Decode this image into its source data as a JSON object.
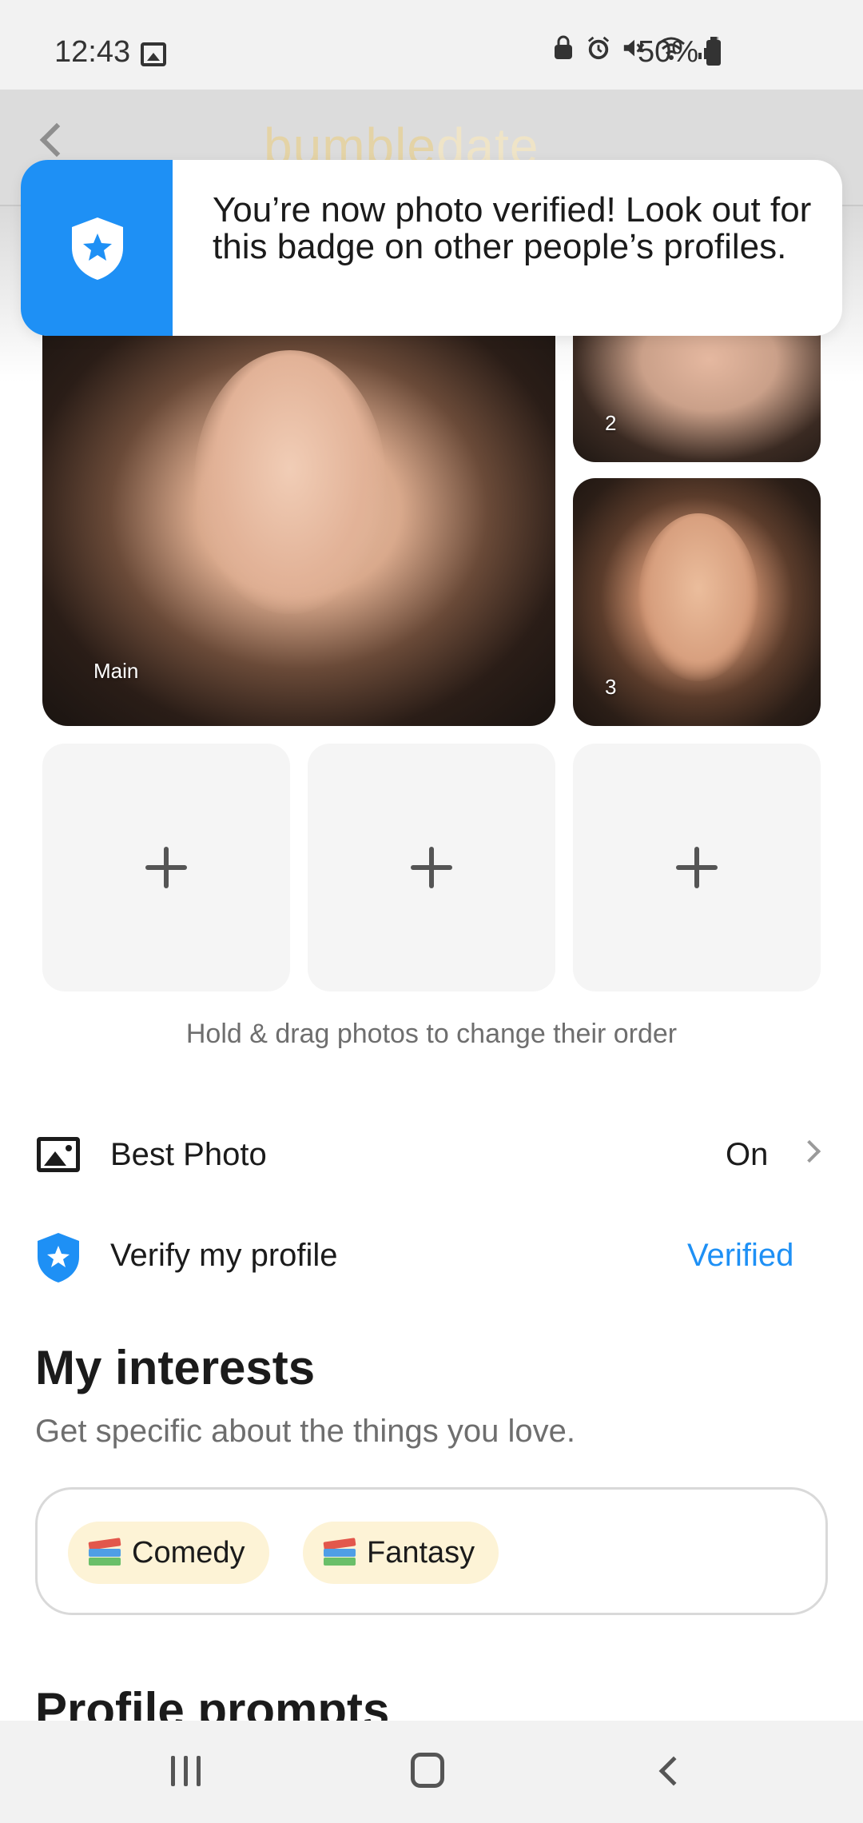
{
  "status_bar": {
    "time": "12:43",
    "battery": "50%",
    "icons": [
      "gallery-icon",
      "lock-icon",
      "alarm-icon",
      "mute-icon",
      "wifi-icon",
      "signal-icon",
      "battery-icon"
    ]
  },
  "header": {
    "brand_primary": "bumble",
    "brand_secondary": "date"
  },
  "toast": {
    "message": "You’re now photo verified! Look out for this badge on other people’s profiles.",
    "icon": "verified-shield-icon",
    "accent_color": "#1e90f5"
  },
  "photos": {
    "main_label": "Main",
    "photo2_label": "2",
    "photo3_label": "3",
    "add_tile_icon": "plus-icon"
  },
  "hint": "Hold & drag photos to change their order",
  "settings": {
    "best_photo": {
      "label": "Best Photo",
      "value": "On",
      "icon": "image-icon"
    },
    "verify": {
      "label": "Verify my profile",
      "value": "Verified",
      "icon": "verified-shield-icon",
      "value_color": "#1e90f5"
    }
  },
  "interests": {
    "title": "My interests",
    "subtitle": "Get specific about the things you love.",
    "chips": [
      {
        "label": "Comedy",
        "icon": "books-icon"
      },
      {
        "label": "Fantasy",
        "icon": "books-icon"
      }
    ]
  },
  "prompts": {
    "title": "Profile prompts"
  },
  "nav_bar": {
    "icons": [
      "recents-icon",
      "home-icon",
      "back-icon"
    ]
  }
}
